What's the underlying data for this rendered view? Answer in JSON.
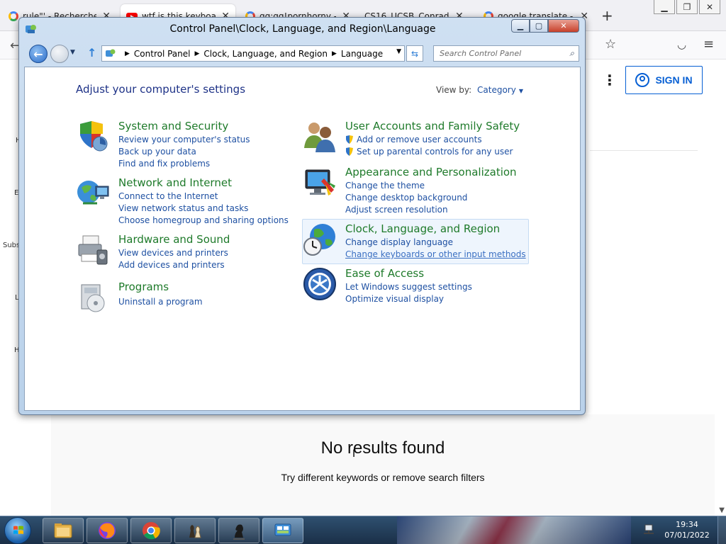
{
  "browser": {
    "tabs": [
      {
        "label": "rule\"' - Recherche Go",
        "icon": "google-icon"
      },
      {
        "label": "wtf is this keyboard L",
        "icon": "youtube-icon"
      },
      {
        "label": "gg:gg!pornhorny - R",
        "icon": "google-icon"
      },
      {
        "label": "CS16_UCSB_Conrad",
        "icon": "none"
      },
      {
        "label": "google translate - R",
        "icon": "google-icon"
      }
    ],
    "new_tab": "+",
    "sign_in": "SIGN IN",
    "left_letters": [
      "H",
      "E",
      "Subs",
      "L",
      "H"
    ],
    "no_results": "No results found",
    "no_results_hint": "Try different keywords or remove search filters"
  },
  "control_panel": {
    "title": "Control Panel\\Clock, Language, and Region\\Language",
    "breadcrumb": [
      "Control Panel",
      "Clock, Language, and Region",
      "Language"
    ],
    "search_placeholder": "Search Control Panel",
    "heading": "Adjust your computer's settings",
    "view_by_label": "View by:",
    "view_by_value": "Category",
    "categories": [
      {
        "title": "System and Security",
        "links": [
          "Review your computer's status",
          "Back up your data",
          "Find and fix problems"
        ]
      },
      {
        "title": "Network and Internet",
        "links": [
          "Connect to the Internet",
          "View network status and tasks",
          "Choose homegroup and sharing options"
        ]
      },
      {
        "title": "Hardware and Sound",
        "links": [
          "View devices and printers",
          "Add devices and printers"
        ]
      },
      {
        "title": "Programs",
        "links": [
          "Uninstall a program"
        ]
      },
      {
        "title": "User Accounts and Family Safety",
        "links": [
          "Add or remove user accounts",
          "Set up parental controls for any user"
        ]
      },
      {
        "title": "Appearance and Personalization",
        "links": [
          "Change the theme",
          "Change desktop background",
          "Adjust screen resolution"
        ]
      },
      {
        "title": "Clock, Language, and Region",
        "links": [
          "Change display language",
          "Change keyboards or other input methods"
        ]
      },
      {
        "title": "Ease of Access",
        "links": [
          "Let Windows suggest settings",
          "Optimize visual display"
        ]
      }
    ]
  },
  "taskbar": {
    "time": "19:34",
    "date": "07/01/2022",
    "apps": [
      "explorer",
      "firefox",
      "chrome",
      "chess-app",
      "chess-knight-app",
      "control-panel"
    ]
  },
  "colors": {
    "category_title": "#1e7a2a",
    "link": "#1e50a2",
    "heading": "#1e3287",
    "sign_in": "#065fd4"
  }
}
